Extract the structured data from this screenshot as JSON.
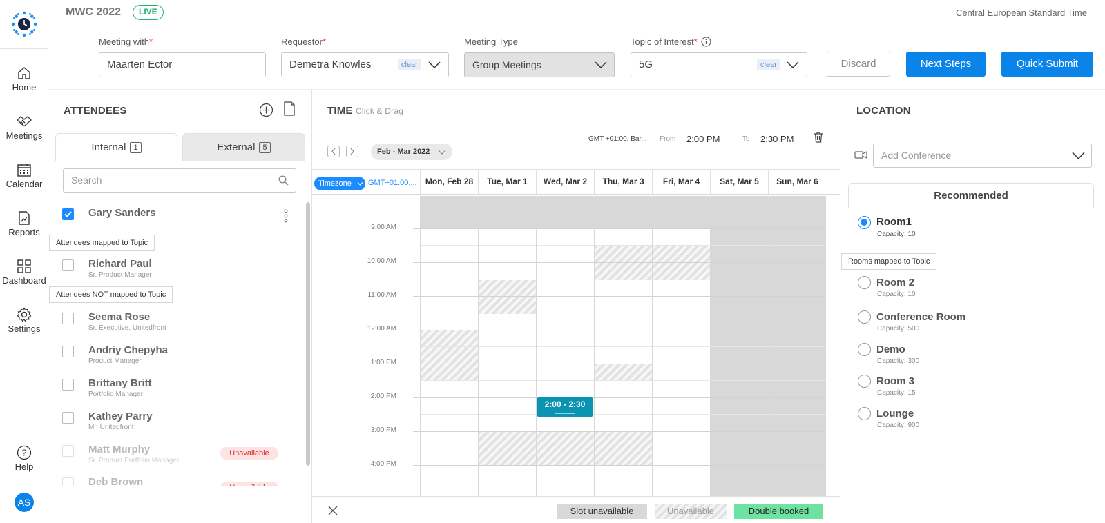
{
  "nav": {
    "items": [
      {
        "label": "Home",
        "icon": "home-icon"
      },
      {
        "label": "Meetings",
        "icon": "handshake-icon"
      },
      {
        "label": "Calendar",
        "icon": "calendar-icon"
      },
      {
        "label": "Reports",
        "icon": "reports-icon"
      },
      {
        "label": "Dashboard",
        "icon": "dashboard-icon"
      },
      {
        "label": "Settings",
        "icon": "gear-icon"
      }
    ],
    "help_label": "Help",
    "avatar_initials": "AS"
  },
  "header": {
    "event_name": "MWC 2022",
    "live_badge": "LIVE",
    "timezone_name": "Central European Standard Time",
    "meeting_with_label": "Meeting with",
    "meeting_with_value": "Maarten Ector",
    "requestor_label": "Requestor",
    "requestor_value": "Demetra Knowles",
    "clear_label": "clear",
    "meeting_type_label": "Meeting Type",
    "meeting_type_value": "Group Meetings",
    "topic_label": "Topic of Interest",
    "topic_value": "5G",
    "discard_label": "Discard",
    "next_steps_label": "Next Steps",
    "quick_submit_label": "Quick Submit"
  },
  "attendees": {
    "title": "ATTENDEES",
    "tab_internal": "Internal",
    "tab_internal_count": "1",
    "tab_external": "External",
    "tab_external_count": "5",
    "search_placeholder": "Search",
    "mapped_tag": "Attendees mapped to Topic",
    "not_mapped_tag": "Attendees NOT mapped to Topic",
    "unavailable_label": "Unavailable",
    "selected": {
      "name": "Gary Sanders",
      "checked": true
    },
    "mapped": [
      {
        "name": "Richard Paul",
        "role": "Sr. Product Manager"
      }
    ],
    "not_mapped": [
      {
        "name": "Seema Rose",
        "role": "Sr. Executive, Unitedfront"
      },
      {
        "name": "Andriy Chepyha",
        "role": "Product Manager"
      },
      {
        "name": "Brittany Britt",
        "role": "Portfolio Manager"
      },
      {
        "name": "Kathey Parry",
        "role": "Mr, Unitedfront"
      },
      {
        "name": "Matt Murphy",
        "role": "Sr. Product Portfolio Manager",
        "unavailable": true
      },
      {
        "name": "Deb Brown",
        "role": "",
        "unavailable": true
      }
    ]
  },
  "time": {
    "title": "TIME",
    "hint": "Click & Drag",
    "gmt_short": "GMT +01:00, Bar...",
    "from_label": "From",
    "from_value": "2:00 PM",
    "to_label": "To",
    "to_value": "2:30 PM",
    "date_range": "Feb - Mar 2022",
    "timezone_button": "Timezone",
    "timezone_value": "GMT+01:00,...",
    "days": [
      "Mon, Feb 28",
      "Tue, Mar 1",
      "Wed, Mar 2",
      "Thu, Mar 3",
      "Fri, Mar 4",
      "Sat, Mar 5",
      "Sun, Mar 6"
    ],
    "hours": [
      "9:00 AM",
      "10:00 AM",
      "11:00 AM",
      "12:00 AM",
      "1:00 PM",
      "2:00 PM",
      "3:00 PM",
      "4:00 PM"
    ],
    "selected_slot": "2:00 - 2:30",
    "legend": {
      "slot_unavailable": "Slot unavailable",
      "unavailable": "Unavailable",
      "double_booked": "Double booked"
    }
  },
  "location": {
    "title": "LOCATION",
    "conference_placeholder": "Add Conference",
    "recommended_tab": "Recommended",
    "mapped_tag": "Rooms mapped to Topic",
    "capacity_prefix": "Capacity:",
    "recommended": [
      {
        "name": "Room1",
        "capacity": "10",
        "selected": true
      }
    ],
    "rooms": [
      {
        "name": "Room 2",
        "capacity": "10"
      },
      {
        "name": "Conference Room",
        "capacity": "500"
      },
      {
        "name": "Demo",
        "capacity": "300"
      },
      {
        "name": "Room 3",
        "capacity": "15"
      },
      {
        "name": "Lounge",
        "capacity": "900"
      }
    ]
  },
  "colors": {
    "primary": "#0a84e8",
    "live": "#1fb36b",
    "selected_slot": "#0b93b3",
    "double_booked": "#6ee3a1",
    "unavailable_red": "#e02424"
  }
}
